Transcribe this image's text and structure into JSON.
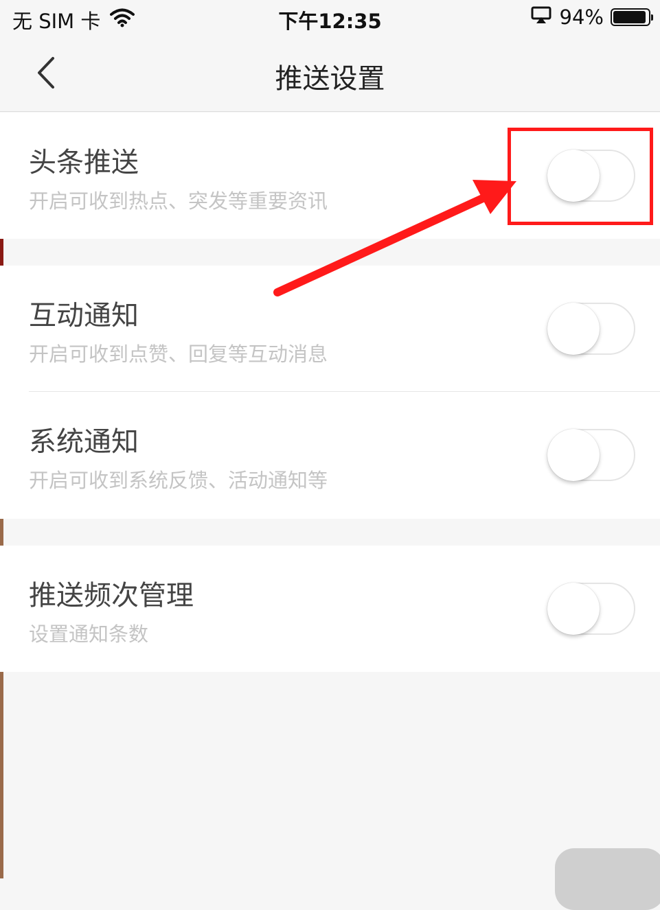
{
  "status_bar": {
    "carrier": "无 SIM 卡",
    "time": "下午12:35",
    "battery": "94%",
    "battery_level": 0.94
  },
  "nav": {
    "title": "推送设置",
    "back_icon": "chevron-left-icon"
  },
  "settings": [
    {
      "title": "头条推送",
      "subtitle": "开启可收到热点、突发等重要资讯",
      "enabled": false
    },
    {
      "title": "互动通知",
      "subtitle": "开启可收到点赞、回复等互动消息",
      "enabled": false
    },
    {
      "title": "系统通知",
      "subtitle": "开启可收到系统反馈、活动通知等",
      "enabled": false
    },
    {
      "title": "推送频次管理",
      "subtitle": "设置通知条数",
      "enabled": false
    }
  ],
  "annotation": {
    "color": "#ff1a1a",
    "icon": "arrow-icon"
  }
}
